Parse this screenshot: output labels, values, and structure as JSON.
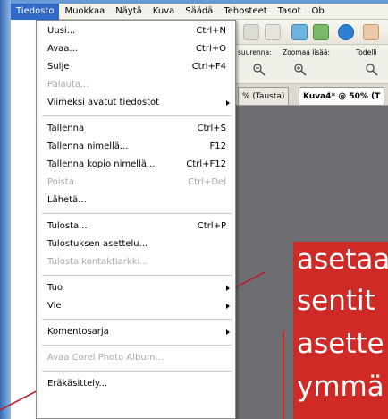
{
  "menubar": {
    "items": [
      "Tiedosto",
      "Muokkaa",
      "Näytä",
      "Kuva",
      "Säädä",
      "Tehosteet",
      "Tasot",
      "Ob"
    ]
  },
  "file_menu": {
    "groups": [
      [
        {
          "label": "Uusi...",
          "shortcut": "Ctrl+N",
          "enabled": true
        },
        {
          "label": "Avaa...",
          "shortcut": "Ctrl+O",
          "enabled": true
        },
        {
          "label": "Sulje",
          "shortcut": "Ctrl+F4",
          "enabled": true
        },
        {
          "label": "Palauta...",
          "shortcut": "",
          "enabled": false
        },
        {
          "label": "Viimeksi avatut tiedostot",
          "shortcut": "",
          "enabled": true,
          "submenu": true
        }
      ],
      [
        {
          "label": "Tallenna",
          "shortcut": "Ctrl+S",
          "enabled": true
        },
        {
          "label": "Tallenna nimellä...",
          "shortcut": "F12",
          "enabled": true
        },
        {
          "label": "Tallenna kopio nimellä...",
          "shortcut": "Ctrl+F12",
          "enabled": true
        },
        {
          "label": "Poista",
          "shortcut": "Ctrl+Del",
          "enabled": false
        },
        {
          "label": "Lähetä...",
          "shortcut": "",
          "enabled": true
        }
      ],
      [
        {
          "label": "Tulosta...",
          "shortcut": "Ctrl+P",
          "enabled": true
        },
        {
          "label": "Tulostuksen asettelu...",
          "shortcut": "",
          "enabled": true
        },
        {
          "label": "Tulosta kontaktiarkki...",
          "shortcut": "",
          "enabled": false
        }
      ],
      [
        {
          "label": "Tuo",
          "shortcut": "",
          "enabled": true,
          "submenu": true
        },
        {
          "label": "Vie",
          "shortcut": "",
          "enabled": true,
          "submenu": true
        }
      ],
      [
        {
          "label": "Komentosarja",
          "shortcut": "",
          "enabled": true,
          "submenu": true
        }
      ],
      [
        {
          "label": "Avaa Corel Photo Album...",
          "shortcut": "",
          "enabled": false
        }
      ],
      [
        {
          "label": "Eräkäsittely...",
          "shortcut": "",
          "enabled": true
        }
      ]
    ]
  },
  "subbar": {
    "zoom_out_label": "suurenna:",
    "zoom_in_label": "Zoomaa lisää:",
    "actual_label": "Todelli"
  },
  "tabs": {
    "items": [
      "% (Tausta)",
      "Kuva4* @ 50% (T"
    ]
  },
  "slide": {
    "lines": [
      "asetaa",
      "sentit",
      "asette",
      "ymmä"
    ]
  },
  "colors": {
    "menu_highlight": "#3169c6",
    "slide_red": "#cf2a26",
    "canvas_gray": "#6e6e72"
  }
}
